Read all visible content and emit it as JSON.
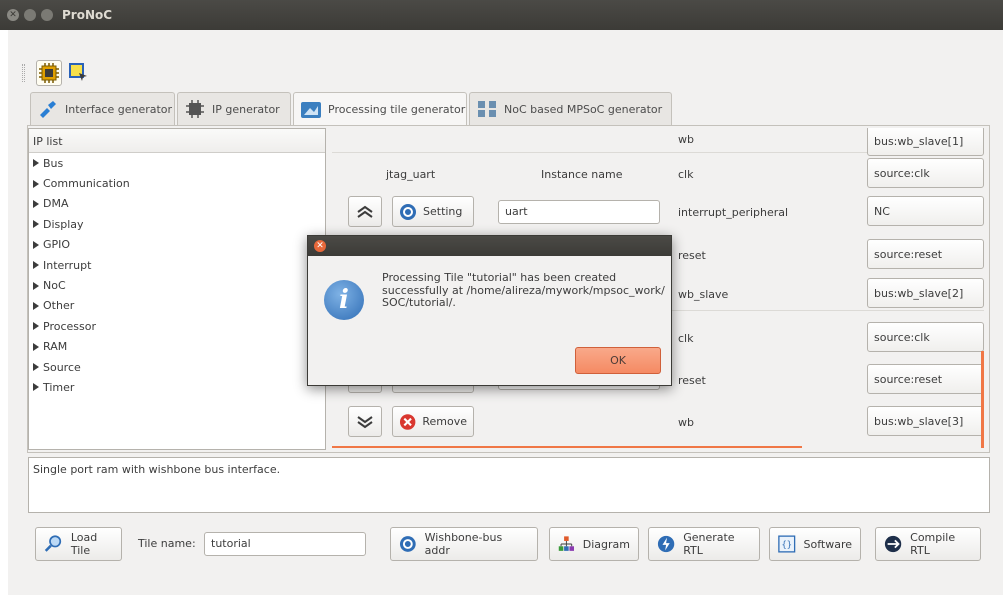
{
  "app": {
    "title": "ProNoC"
  },
  "tabs": [
    {
      "label": "Interface generator"
    },
    {
      "label": "IP generator"
    },
    {
      "label": "Processing tile generator"
    },
    {
      "label": "NoC based MPSoC generator"
    }
  ],
  "ip_list": {
    "header": "IP list",
    "items": [
      "Bus",
      "Communication",
      "DMA",
      "Display",
      "GPIO",
      "Interrupt",
      "NoC",
      "Other",
      "Processor",
      "RAM",
      "Source",
      "Timer"
    ]
  },
  "instance": {
    "ip_name": "jtag_uart",
    "instance_label": "Instance name",
    "setting_label": "Setting",
    "instance_value": "uart",
    "remove_label": "Remove"
  },
  "ports": [
    {
      "name": "wb",
      "value": "bus:wb_slave[1]"
    },
    {
      "name": "clk",
      "value": "source:clk"
    },
    {
      "name": "interrupt_peripheral",
      "value": "NC"
    },
    {
      "name": "reset",
      "value": "source:reset"
    },
    {
      "name": "wb_slave",
      "value": "bus:wb_slave[2]"
    },
    {
      "name": "clk",
      "value": "source:clk"
    },
    {
      "name": "reset",
      "value": "source:reset"
    },
    {
      "name": "wb",
      "value": "bus:wb_slave[3]"
    }
  ],
  "description": "Single port ram with wishbone bus interface.",
  "bottom": {
    "load_tile": "Load Tile",
    "tile_name_label": "Tile name:",
    "tile_name_value": "tutorial",
    "wishbone": "Wishbone-bus addr",
    "diagram": "Diagram",
    "generate_rtl": "Generate RTL",
    "software": "Software",
    "compile_rtl": "Compile RTL"
  },
  "dialog": {
    "message": "Processing Tile  \"tutorial\" has been created successfully at /home/alireza/mywork/mpsoc_work/ SOC/tutorial/.",
    "ok": "OK"
  }
}
